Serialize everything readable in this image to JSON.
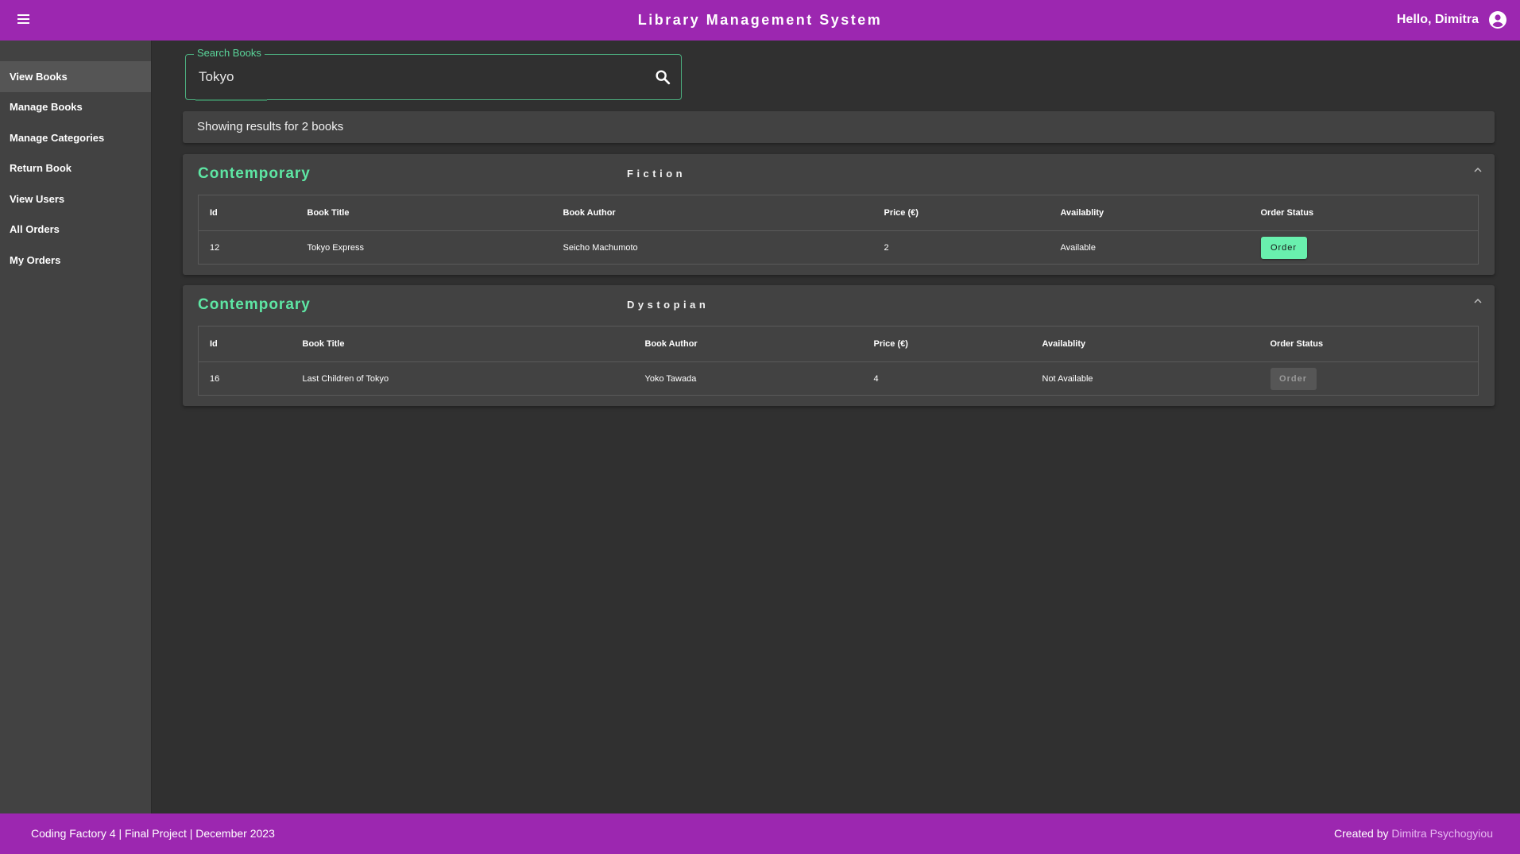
{
  "header": {
    "title": "Library Management System",
    "greeting": "Hello, Dimitra",
    "menu_icon": "hamburger-menu-icon",
    "account_icon": "account-circle-icon"
  },
  "sidebar": {
    "items": [
      {
        "label": "View Books",
        "active": true
      },
      {
        "label": "Manage Books",
        "active": false
      },
      {
        "label": "Manage Categories",
        "active": false
      },
      {
        "label": "Return Book",
        "active": false
      },
      {
        "label": "View Users",
        "active": false
      },
      {
        "label": "All Orders",
        "active": false
      },
      {
        "label": "My Orders",
        "active": false
      }
    ]
  },
  "search": {
    "label": "Search Books",
    "value": "Tokyo",
    "icon": "search-icon"
  },
  "results": {
    "summary": "Showing results for 2 books"
  },
  "columns": [
    "Id",
    "Book Title",
    "Book Author",
    "Price (€)",
    "Availablity",
    "Order Status"
  ],
  "panels": [
    {
      "category": "Contemporary",
      "genre": "Fiction",
      "rows": [
        {
          "id": "12",
          "title": "Tokyo Express",
          "author": "Seicho Machumoto",
          "price": "2",
          "availability": "Available",
          "order_label": "Order",
          "order_enabled": true
        }
      ]
    },
    {
      "category": "Contemporary",
      "genre": "Dystopian",
      "rows": [
        {
          "id": "16",
          "title": "Last Children of Tokyo",
          "author": "Yoko Tawada",
          "price": "4",
          "availability": "Not Available",
          "order_label": "Order",
          "order_enabled": false
        }
      ]
    }
  ],
  "footer": {
    "left": "Coding Factory 4 | Final Project | December 2023",
    "created_by": "Created by",
    "author": "Dimitra Psychogyiou"
  },
  "colors": {
    "brand": "#9c27b0",
    "accent": "#69f0ae",
    "background": "#303030",
    "surface": "#424242"
  }
}
